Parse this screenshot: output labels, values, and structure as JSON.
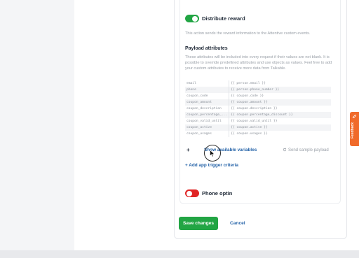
{
  "distribute_reward": {
    "label": "Distribute reward",
    "enabled": true,
    "description": "This action sends the reward information to the Attentive custom events."
  },
  "payload": {
    "title": "Payload attributes",
    "description": "These attributes will be included into every request if their values are not blank. It is possible to override predefined attributes and use objects as values. Feel free to add your custom attributes to receive more data from Talkable.",
    "rows": [
      {
        "key": "email",
        "value": "{{ person.email }}"
      },
      {
        "key": "phone",
        "value": "{{ person.phone_number }}"
      },
      {
        "key": "coupon_code",
        "value": "{{ coupon.code }}"
      },
      {
        "key": "coupon_amount",
        "value": "{{ coupon.amount }}"
      },
      {
        "key": "coupon_description",
        "value": "{{ coupon.description }}"
      },
      {
        "key": "coupon_percentage_...",
        "value": "{{ coupon.percentage_discount }}"
      },
      {
        "key": "coupon_valid_until",
        "value": "{{ coupon.valid_until }}"
      },
      {
        "key": "coupon_active",
        "value": "{{ coupon.active }}"
      },
      {
        "key": "coupon_usages",
        "value": "{{ coupon.usages }}"
      }
    ],
    "add_symbol": "+",
    "show_variables": "Show available variables",
    "send_sample": "Send sample payload"
  },
  "add_trigger": "+ Add app trigger criteria",
  "phone_optin": {
    "label": "Phone optin",
    "enabled": false
  },
  "actions": {
    "save": "Save changes",
    "cancel": "Cancel"
  },
  "feedback": "Feedback",
  "colors": {
    "accent_green": "#22a544",
    "toggle_off_red": "#e02424",
    "link_blue": "#2563a8",
    "feedback_orange": "#f06a2a"
  },
  "icons": [
    "refresh-icon",
    "plus-icon",
    "cursor-icon",
    "feedback-icon"
  ]
}
